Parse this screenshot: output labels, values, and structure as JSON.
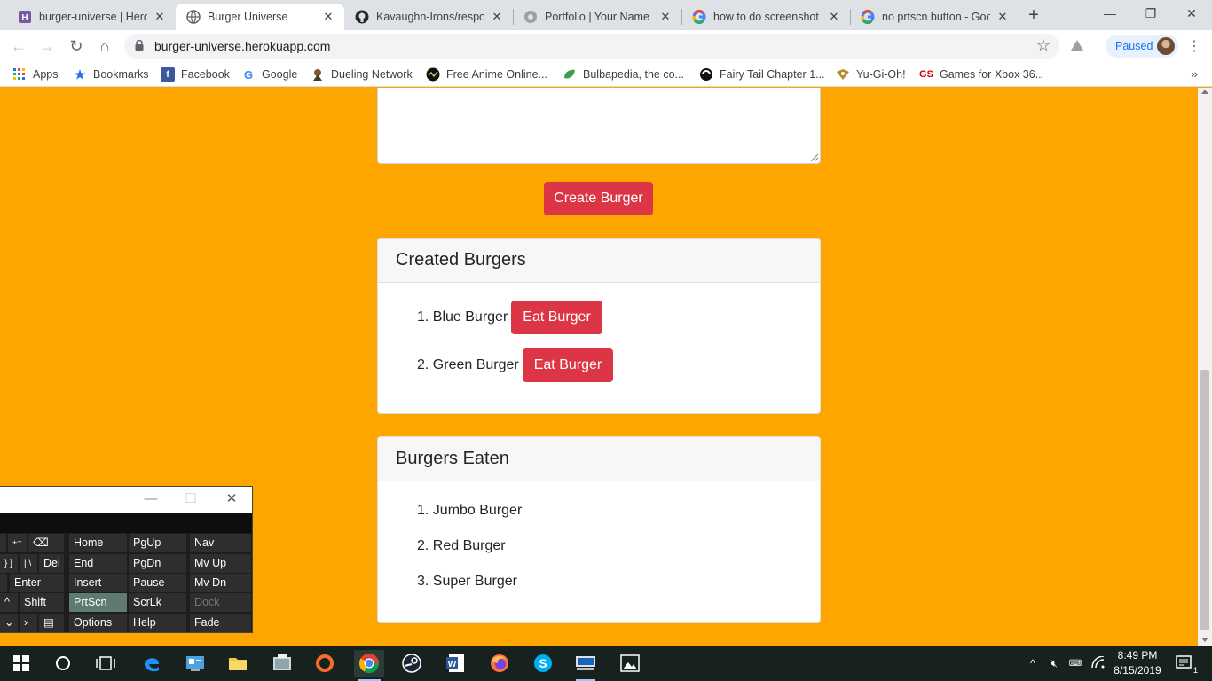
{
  "browser": {
    "tabs": [
      {
        "title": "burger-universe | Herok",
        "active": false
      },
      {
        "title": "Burger Universe",
        "active": true
      },
      {
        "title": "Kavaughn-Irons/respon",
        "active": false
      },
      {
        "title": "Portfolio | Your Name",
        "active": false
      },
      {
        "title": "how to do screenshot -",
        "active": false
      },
      {
        "title": "no prtscn button - Goo",
        "active": false
      }
    ],
    "url": "burger-universe.herokuapp.com",
    "profile_label": "Paused",
    "bookmarks": [
      {
        "label": "Apps"
      },
      {
        "label": "Bookmarks"
      },
      {
        "label": "Facebook"
      },
      {
        "label": "Google"
      },
      {
        "label": "Dueling Network"
      },
      {
        "label": "Free Anime Online..."
      },
      {
        "label": "Bulbapedia, the co..."
      },
      {
        "label": "Fairy Tail Chapter 1..."
      },
      {
        "label": "Yu-Gi-Oh!"
      },
      {
        "label": "Games for Xbox 36..."
      }
    ]
  },
  "page": {
    "create_button": "Create Burger",
    "created": {
      "title": "Created Burgers",
      "items": [
        "1. Blue Burger",
        "2. Green Burger"
      ],
      "eat_label": "Eat Burger"
    },
    "eaten": {
      "title": "Burgers Eaten",
      "items": [
        "1. Jumbo Burger",
        "2. Red Burger",
        "3. Super Burger"
      ]
    },
    "colors": {
      "background": "#ffa500",
      "danger": "#dc3545"
    }
  },
  "keyboard": {
    "keys": {
      "home": "Home",
      "pgup": "PgUp",
      "nav": "Nav",
      "del": "Del",
      "end": "End",
      "pgdn": "PgDn",
      "mvup": "Mv Up",
      "enter": "Enter",
      "insert": "Insert",
      "pause": "Pause",
      "mvdn": "Mv Dn",
      "shift": "Shift",
      "prtscn": "PrtScn",
      "scrlk": "ScrLk",
      "dock": "Dock",
      "options": "Options",
      "help": "Help",
      "fade": "Fade"
    }
  },
  "taskbar": {
    "time": "8:49 PM",
    "date": "8/15/2019",
    "notification_count": "1"
  }
}
